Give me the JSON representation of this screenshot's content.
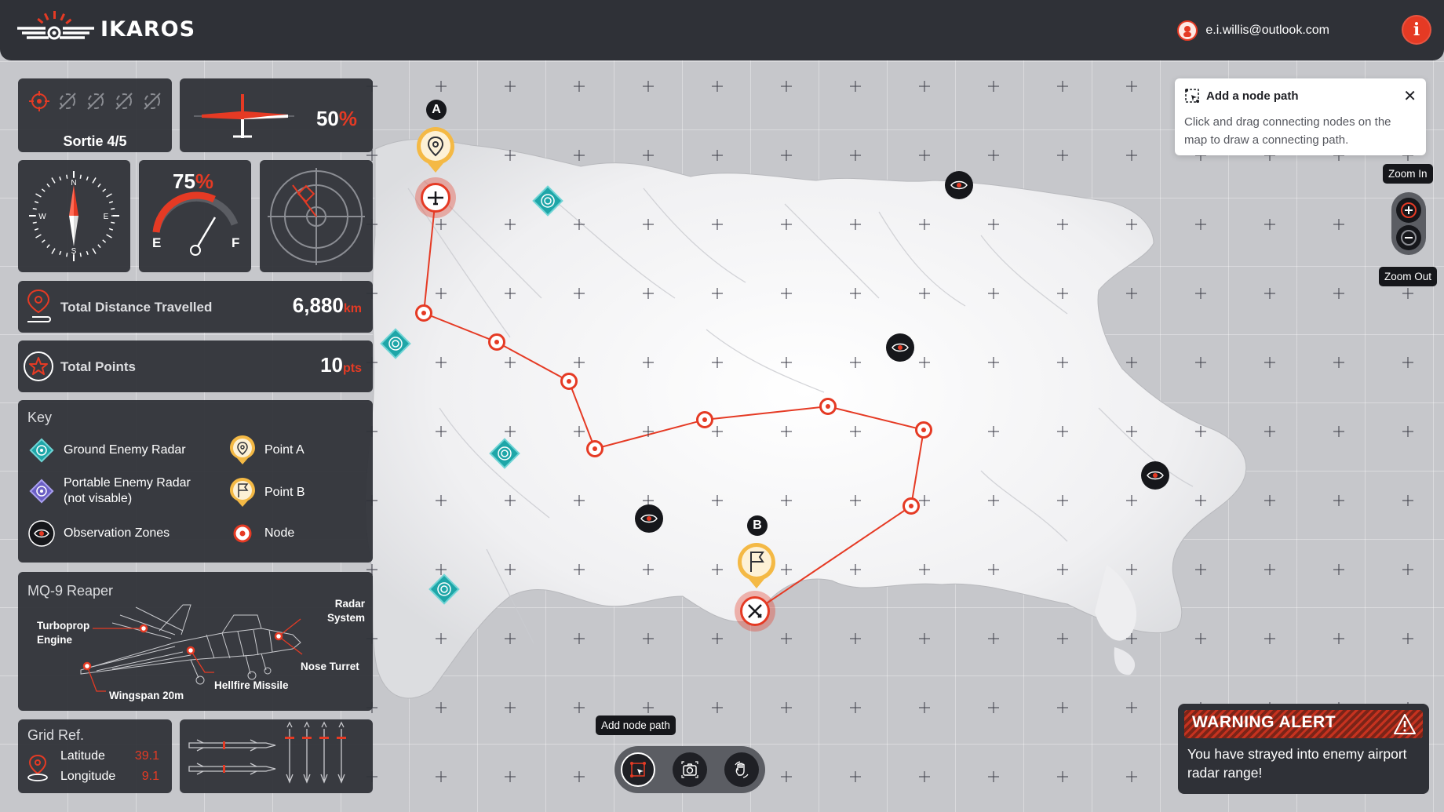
{
  "app": {
    "name": "IKAROS",
    "user_email": "e.i.willis@outlook.com"
  },
  "stats": {
    "sortie_label": "Sortie 4/5",
    "progress_value": "50",
    "progress_unit": "%",
    "fuel_value": "75",
    "fuel_unit": "%",
    "fuel_empty": "E",
    "fuel_full": "F",
    "compass_n": "N",
    "compass_s": "S",
    "compass_e": "E",
    "compass_w": "W",
    "distance_label": "Total Distance Travelled",
    "distance_value": "6,880",
    "distance_unit": "km",
    "points_label": "Total Points",
    "points_value": "10",
    "points_unit": "pts"
  },
  "key": {
    "title": "Key",
    "items": [
      {
        "label": "Ground Enemy Radar",
        "icon": "ground-radar-icon"
      },
      {
        "label": "Portable Enemy Radar\n(not visable)",
        "icon": "portable-radar-icon"
      },
      {
        "label": "Observation Zones",
        "icon": "eye-icon"
      },
      {
        "label": "Point A",
        "icon": "map-pin-icon"
      },
      {
        "label": "Point B",
        "icon": "flag-pin-icon"
      },
      {
        "label": "Node",
        "icon": "node-icon"
      }
    ]
  },
  "aircraft": {
    "title": "MQ-9 Reaper",
    "labels": {
      "turboprop": "Turboprop\nEngine",
      "radar": "Radar\nSystem",
      "nose": "Nose Turret",
      "hellfire": "Hellfire Missile",
      "wingspan": "Wingspan 20m"
    }
  },
  "grid_ref": {
    "title": "Grid Ref.",
    "lat_label": "Latitude",
    "lat_value": "39.1",
    "lon_label": "Longitude",
    "lon_value": "9.1"
  },
  "map": {
    "point_a_letter": "A",
    "point_b_letter": "B"
  },
  "hint": {
    "title": "Add a node path",
    "body": "Click and drag connecting nodes on the map to draw a connecting path."
  },
  "zoom": {
    "in_label": "Zoom In",
    "out_label": "Zoom Out"
  },
  "toolbar": {
    "tooltip": "Add node path"
  },
  "warning": {
    "title": "WARNING ALERT",
    "body": "You have strayed into enemy airport radar range!"
  },
  "colors": {
    "accent": "#e53a24",
    "panel": "#2f3137",
    "radar": "#1ea6a8",
    "pin": "#f4b945"
  }
}
